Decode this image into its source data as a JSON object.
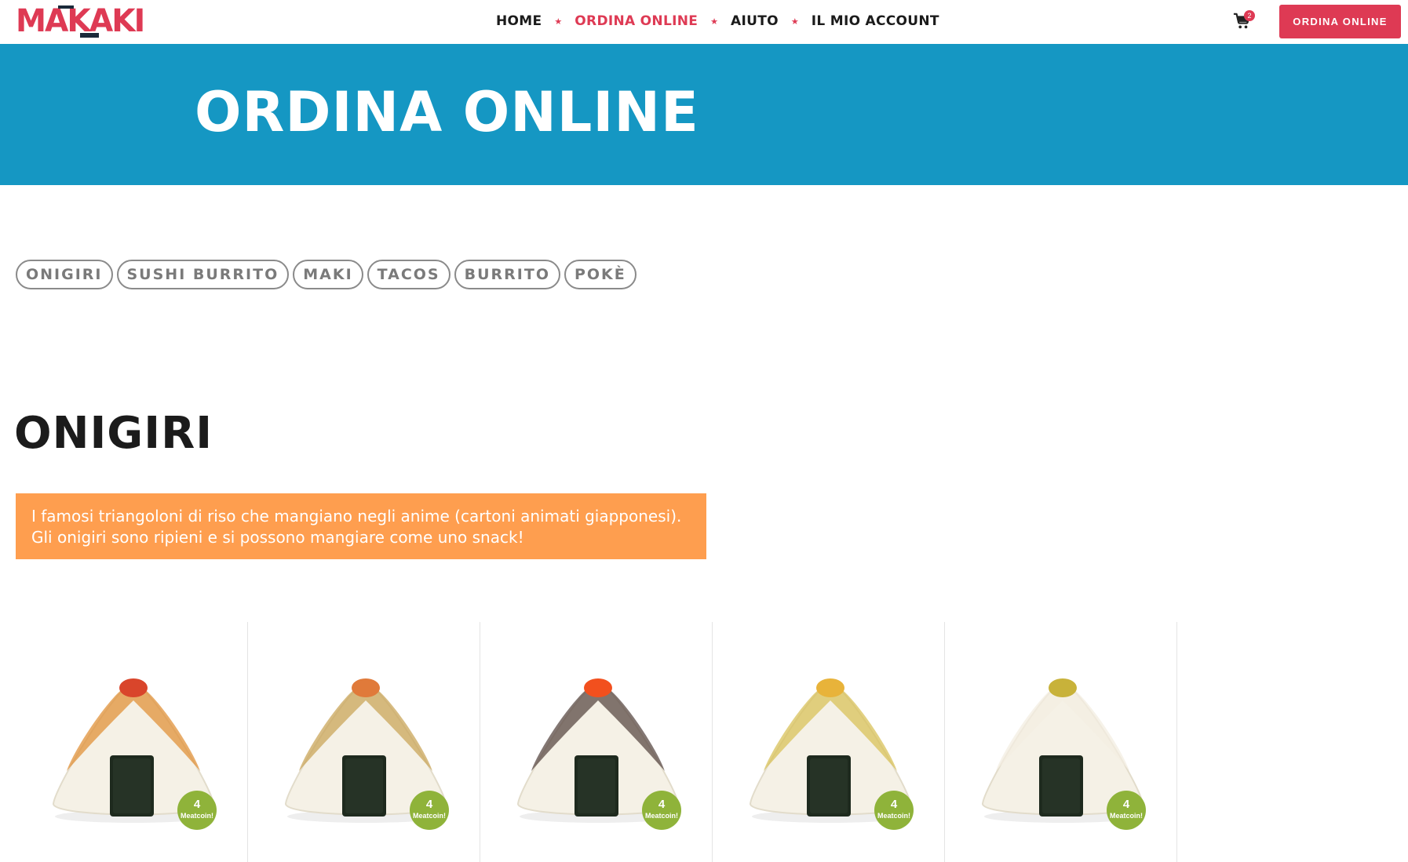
{
  "brand": {
    "logo_text": "MAKAKI",
    "accent": "#de3a54",
    "hero_bg": "#1597c3",
    "desc_bg": "#fe9e4f",
    "coin_bg": "#8fb33a"
  },
  "nav": {
    "items": [
      {
        "label": "HOME",
        "active": false
      },
      {
        "label": "ORDINA ONLINE",
        "active": true
      },
      {
        "label": "AIUTO",
        "active": false
      },
      {
        "label": "IL MIO ACCOUNT",
        "active": false
      }
    ],
    "separator": "★"
  },
  "cart": {
    "icon": "cart-icon",
    "count": "2"
  },
  "cta": {
    "label": "ORDINA ONLINE"
  },
  "hero": {
    "title": "ORDINA ONLINE"
  },
  "categories": [
    "ONIGIRI",
    "SUSHI BURRITO",
    "MAKI",
    "TACOS",
    "BURRITO",
    "POKÈ"
  ],
  "section": {
    "title": "ONIGIRI",
    "description": "I famosi triangoloni di riso che mangiano negli anime (cartoni animati giapponesi). Gli onigiri sono ripieni e si possono mangiare come uno snack!"
  },
  "products": [
    {
      "coins": "4",
      "coin_label": "Meatcoin!",
      "topping": "#d9452b",
      "crust": "#e0913a"
    },
    {
      "coins": "4",
      "coin_label": "Meatcoin!",
      "topping": "#e07a3a",
      "crust": "#c9a55a"
    },
    {
      "coins": "4",
      "coin_label": "Meatcoin!",
      "topping": "#f2501e",
      "crust": "#5a4a44"
    },
    {
      "coins": "4",
      "coin_label": "Meatcoin!",
      "topping": "#e8b33a",
      "crust": "#d8c25a"
    },
    {
      "coins": "4",
      "coin_label": "Meatcoin!",
      "topping": "#c8b23a",
      "crust": "#f3eee2"
    }
  ]
}
